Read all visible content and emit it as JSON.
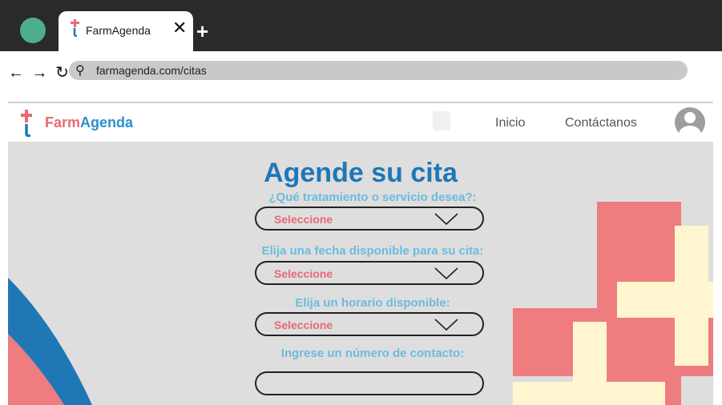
{
  "browser": {
    "tab_title": "FarmAgenda",
    "tab_close": "✕",
    "new_tab": "+",
    "nav_buttons": "← → ↻",
    "url": "farmagenda.com/citas"
  },
  "header": {
    "brand_part1": "Farm",
    "brand_part2": "Agenda",
    "nav": [
      "Inicio",
      "Contáctanos"
    ]
  },
  "form": {
    "title": "Agende su cita",
    "fields": [
      {
        "label": "¿Qué tratamiento o servicio desea?:",
        "value": "Seleccione"
      },
      {
        "label": "Elija una fecha disponible para su cita:",
        "value": "Seleccione"
      },
      {
        "label": "Elija un horario disponible:",
        "value": "Seleccione"
      },
      {
        "label": "Ingrese un número de contacto:",
        "value": ""
      }
    ]
  },
  "colors": {
    "accent_blue": "#1f77b6",
    "label_blue": "#6cbbdf",
    "pink": "#e86a71",
    "cream": "#fff6cf",
    "background": "#dedede"
  }
}
